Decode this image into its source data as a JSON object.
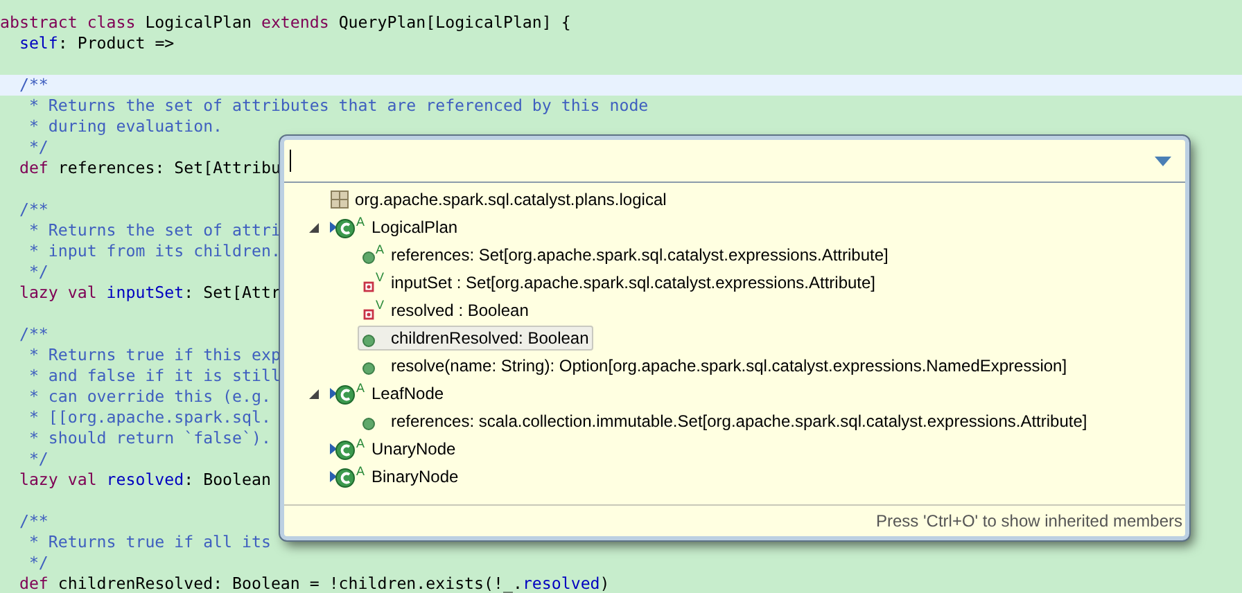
{
  "editor": {
    "lines": [
      {
        "current": false,
        "segments": [
          {
            "kind": "keyword",
            "text": "abstract class "
          },
          {
            "kind": "plain",
            "text": "LogicalPlan "
          },
          {
            "kind": "keyword",
            "text": "extends "
          },
          {
            "kind": "plain",
            "text": "QueryPlan[LogicalPlan] {"
          }
        ]
      },
      {
        "current": false,
        "segments": [
          {
            "kind": "field",
            "text": "  self"
          },
          {
            "kind": "plain",
            "text": ": Product =>"
          }
        ]
      },
      {
        "current": false
      },
      {
        "current": true,
        "segments": [
          {
            "kind": "comment",
            "text": "  /**"
          }
        ]
      },
      {
        "current": false,
        "segments": [
          {
            "kind": "comment",
            "text": "   * Returns the set of attributes that are referenced by this node"
          }
        ]
      },
      {
        "current": false,
        "segments": [
          {
            "kind": "comment",
            "text": "   * during evaluation."
          }
        ]
      },
      {
        "current": false,
        "segments": [
          {
            "kind": "comment",
            "text": "   */"
          }
        ]
      },
      {
        "current": false,
        "segments": [
          {
            "kind": "keyword",
            "text": "  def "
          },
          {
            "kind": "plain",
            "text": "references: Set[Attribu"
          }
        ]
      },
      {
        "current": false
      },
      {
        "current": false,
        "segments": [
          {
            "kind": "comment",
            "text": "  /**"
          }
        ]
      },
      {
        "current": false,
        "segments": [
          {
            "kind": "comment",
            "text": "   * Returns the set of attri"
          }
        ]
      },
      {
        "current": false,
        "segments": [
          {
            "kind": "comment",
            "text": "   * input from its children."
          }
        ]
      },
      {
        "current": false,
        "segments": [
          {
            "kind": "comment",
            "text": "   */"
          }
        ]
      },
      {
        "current": false,
        "segments": [
          {
            "kind": "keyword",
            "text": "  lazy val "
          },
          {
            "kind": "field",
            "text": "inputSet"
          },
          {
            "kind": "plain",
            "text": ": Set[Attr"
          }
        ]
      },
      {
        "current": false
      },
      {
        "current": false,
        "segments": [
          {
            "kind": "comment",
            "text": "  /**"
          }
        ]
      },
      {
        "current": false,
        "segments": [
          {
            "kind": "comment",
            "text": "   * Returns true if this exp"
          }
        ]
      },
      {
        "current": false,
        "segments": [
          {
            "kind": "comment",
            "text": "   * and false if it is still"
          }
        ]
      },
      {
        "current": false,
        "segments": [
          {
            "kind": "comment",
            "text": "   * can override this (e.g."
          }
        ]
      },
      {
        "current": false,
        "segments": [
          {
            "kind": "comment",
            "text": "   * [[org.apache.spark.sql."
          }
        ]
      },
      {
        "current": false,
        "segments": [
          {
            "kind": "comment",
            "text": "   * should return `false`)."
          }
        ]
      },
      {
        "current": false,
        "segments": [
          {
            "kind": "comment",
            "text": "   */"
          }
        ]
      },
      {
        "current": false,
        "segments": [
          {
            "kind": "keyword",
            "text": "  lazy val "
          },
          {
            "kind": "field",
            "text": "resolved"
          },
          {
            "kind": "plain",
            "text": ": Boolean"
          }
        ]
      },
      {
        "current": false
      },
      {
        "current": false,
        "segments": [
          {
            "kind": "comment",
            "text": "  /**"
          }
        ]
      },
      {
        "current": false,
        "segments": [
          {
            "kind": "comment",
            "text": "   * Returns true if all its"
          }
        ]
      },
      {
        "current": false,
        "segments": [
          {
            "kind": "comment",
            "text": "   */"
          }
        ]
      },
      {
        "current": false,
        "segments": [
          {
            "kind": "keyword",
            "text": "  def "
          },
          {
            "kind": "plain",
            "text": "childrenResolved: Boolean = !children.exists(!_."
          },
          {
            "kind": "field",
            "text": "resolved"
          },
          {
            "kind": "plain",
            "text": ")"
          }
        ]
      }
    ]
  },
  "outline_popup": {
    "items": [
      {
        "kind": "package",
        "label": "org.apache.spark.sql.catalyst.plans.logical",
        "selected": false
      },
      {
        "kind": "class",
        "badge": "A",
        "label": "LogicalPlan",
        "selected": false,
        "expanded": true,
        "children": [
          {
            "kind": "def",
            "badge": "A",
            "label": "references: Set[org.apache.spark.sql.catalyst.expressions.Attribute]",
            "selected": false
          },
          {
            "kind": "val",
            "badge": "V",
            "label": "inputSet : Set[org.apache.spark.sql.catalyst.expressions.Attribute]",
            "selected": false
          },
          {
            "kind": "val",
            "badge": "V",
            "label": "resolved : Boolean",
            "selected": false
          },
          {
            "kind": "def",
            "label": "childrenResolved: Boolean",
            "selected": true
          },
          {
            "kind": "def",
            "label": "resolve(name: String): Option[org.apache.spark.sql.catalyst.expressions.NamedExpression]",
            "selected": false
          }
        ]
      },
      {
        "kind": "class",
        "badge": "A",
        "label": "LeafNode",
        "selected": false,
        "expanded": true,
        "children": [
          {
            "kind": "def",
            "label": "references: scala.collection.immutable.Set[org.apache.spark.sql.catalyst.expressions.Attribute]",
            "selected": false
          }
        ]
      },
      {
        "kind": "class",
        "badge": "A",
        "label": "UnaryNode",
        "selected": false
      },
      {
        "kind": "class",
        "badge": "A",
        "label": "BinaryNode",
        "selected": false
      }
    ],
    "status": "Press 'Ctrl+O' to show inherited members"
  }
}
